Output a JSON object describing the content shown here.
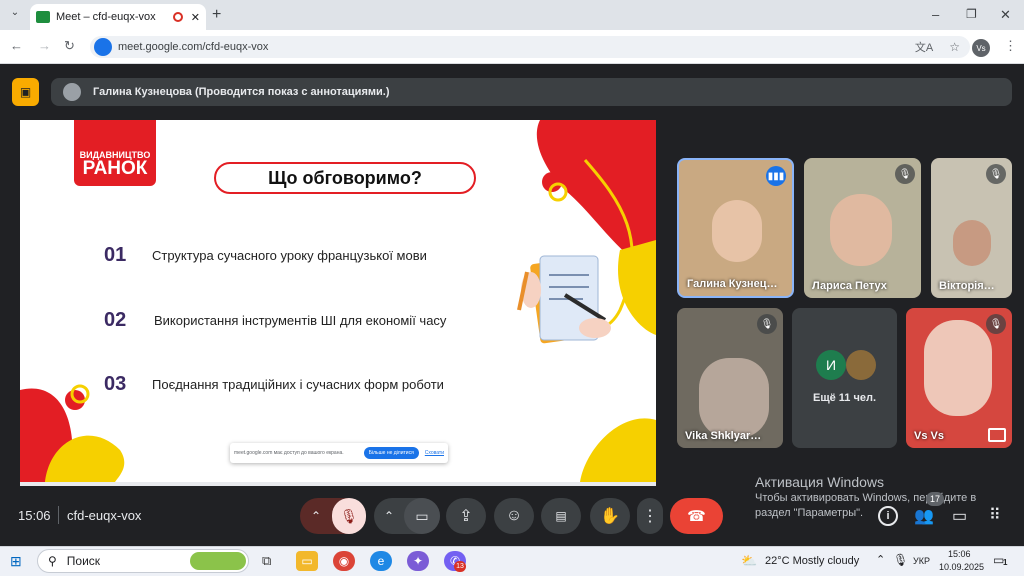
{
  "browser": {
    "tab_title": "Meet – cfd-euqx-vox",
    "url": "meet.google.com/cfd-euqx-vox",
    "profile_initials": "Vs",
    "new_tab": "+",
    "min": "–",
    "max": "❐",
    "close": "✕"
  },
  "banner": {
    "presenter": "Галина Кузнецова (Проводится показ с аннотациями.)"
  },
  "slide": {
    "brand_top": "ВИДАВНИЦТВО",
    "brand_bottom": "РАНОК",
    "heading": "Що обговоримо?",
    "items": [
      {
        "num": "01",
        "text": "Структура сучасного уроку французької мови"
      },
      {
        "num": "02",
        "text": "Використання інструментів ШІ для економії часу"
      },
      {
        "num": "03",
        "text": "Поєднання традиційних і сучасних форм роботи"
      }
    ],
    "share_notice": "meet.google.com має доступ до вашого екрана.",
    "stop_share": "Більше не ділитися",
    "hide": "Сховати"
  },
  "participants": [
    {
      "name": "Галина Кузнец…",
      "bg": "#c9a982"
    },
    {
      "name": "Лариса Петух",
      "bg": "#b7b29a"
    },
    {
      "name": "Вікторія…",
      "bg": "#c8c2b2"
    },
    {
      "name": "Vika Shklyar…",
      "bg": "#6f6a60"
    },
    {
      "name": "Vs Vs",
      "bg": "#d5473f"
    }
  ],
  "more": {
    "initial": "И",
    "label": "Ещё 11 чел."
  },
  "controls": {
    "time": "15:06",
    "meeting_code": "cfd-euqx-vox",
    "participants_badge": "17"
  },
  "watermark": {
    "title": "Активация Windows",
    "line1": "Чтобы активировать Windows, перейдите в",
    "line2": "раздел \"Параметры\"."
  },
  "taskbar": {
    "search": "Поиск",
    "weather": "22°C  Mostly cloudy",
    "lang": "УКР",
    "time": "15:06",
    "date": "10.09.2025",
    "notif": "1",
    "viber_badge": "13"
  }
}
